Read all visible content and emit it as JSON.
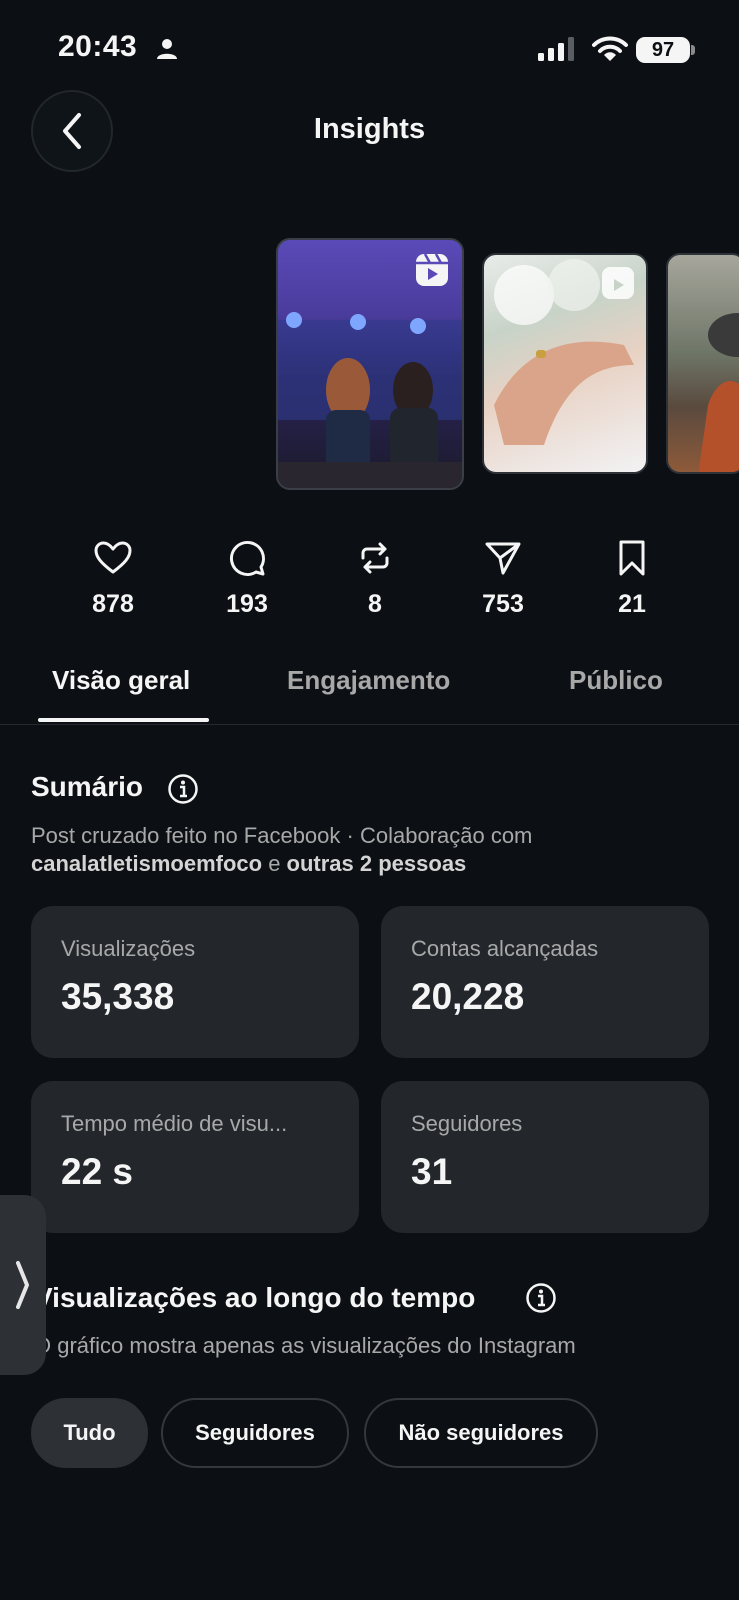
{
  "status_bar": {
    "time": "20:43",
    "battery": "97"
  },
  "header": {
    "title": "Insights"
  },
  "stats": [
    {
      "icon": "heart-icon",
      "value": "878"
    },
    {
      "icon": "comment-icon",
      "value": "193"
    },
    {
      "icon": "repost-icon",
      "value": "8"
    },
    {
      "icon": "share-icon",
      "value": "753"
    },
    {
      "icon": "bookmark-icon",
      "value": "21"
    }
  ],
  "tabs": [
    {
      "label": "Visão geral",
      "active": true
    },
    {
      "label": "Engajamento",
      "active": false
    },
    {
      "label": "Público",
      "active": false
    }
  ],
  "summary": {
    "title": "Sumário",
    "line1": "Post cruzado feito no Facebook · Colaboração com",
    "collaborator": "canalatletismoemfoco",
    "connector": " e ",
    "others": "outras 2 pessoas"
  },
  "cards": [
    {
      "label": "Visualizações",
      "value": "35,338"
    },
    {
      "label": "Contas alcançadas",
      "value": "20,228"
    },
    {
      "label": "Tempo médio de visu...",
      "value": "22 s"
    },
    {
      "label": "Seguidores",
      "value": "31"
    }
  ],
  "views_section": {
    "title": "Visualizações ao longo do tempo",
    "subtitle": "O gráfico mostra apenas as visualizações do Instagram"
  },
  "filters": [
    {
      "label": "Tudo",
      "active": true
    },
    {
      "label": "Seguidores",
      "active": false
    },
    {
      "label": "Não seguidores",
      "active": false
    }
  ],
  "colors": {
    "background": "#0c1014",
    "card": "#23272c",
    "text": "#f5f5f5",
    "muted": "#a8a8a8"
  }
}
